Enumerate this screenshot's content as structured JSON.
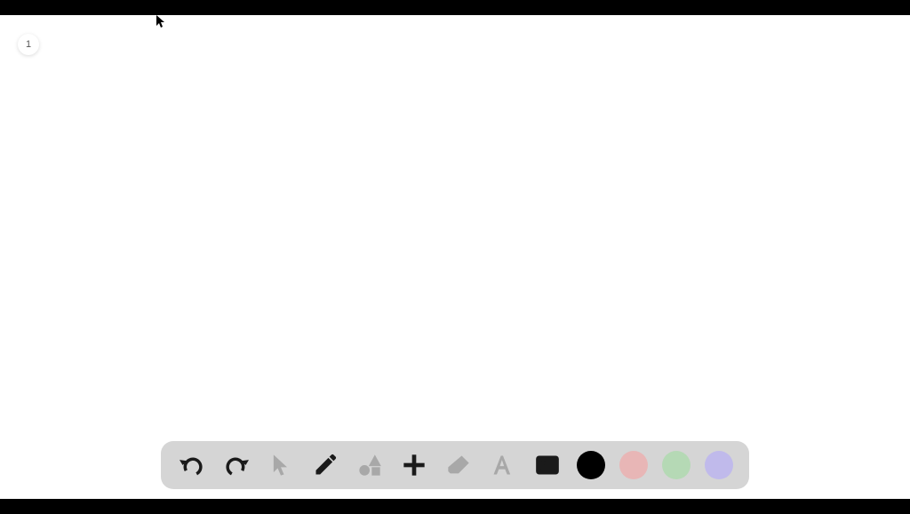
{
  "page": {
    "number": "1"
  },
  "toolbar": {
    "tools": [
      {
        "name": "undo",
        "icon": "undo-icon"
      },
      {
        "name": "redo",
        "icon": "redo-icon"
      },
      {
        "name": "select",
        "icon": "pointer-icon"
      },
      {
        "name": "pencil",
        "icon": "pencil-icon"
      },
      {
        "name": "shapes",
        "icon": "shapes-icon"
      },
      {
        "name": "add",
        "icon": "plus-icon"
      },
      {
        "name": "eraser",
        "icon": "eraser-icon"
      },
      {
        "name": "text",
        "icon": "text-icon"
      },
      {
        "name": "image",
        "icon": "image-icon"
      }
    ],
    "colors": [
      {
        "name": "black",
        "hex": "#000000"
      },
      {
        "name": "pink",
        "hex": "#e8b6b6"
      },
      {
        "name": "green",
        "hex": "#b5d9b5"
      },
      {
        "name": "purple",
        "hex": "#c0baeb"
      }
    ]
  }
}
